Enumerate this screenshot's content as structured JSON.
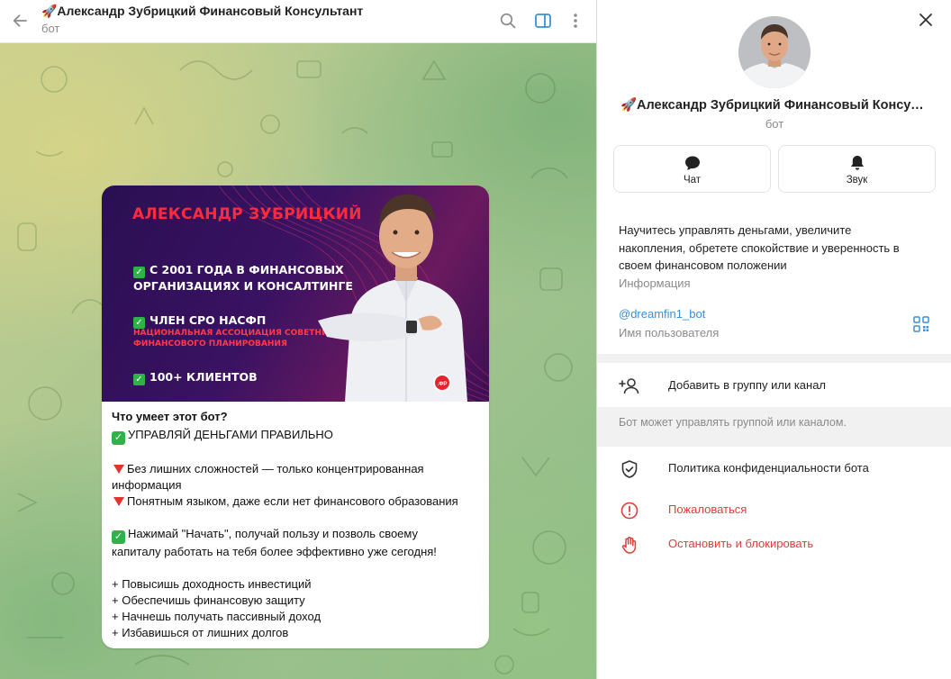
{
  "header": {
    "title": "🚀Александр Зубрицкий Финансовый Консультант",
    "subtitle": "бот",
    "icons": [
      "back-arrow-icon",
      "search-icon",
      "sidebar-toggle-icon",
      "more-vertical-icon"
    ]
  },
  "message": {
    "promo": {
      "name": "АЛЕКСАНДР ЗУБРИЦКИЙ",
      "line1a": "С 2001 ГОДА В ФИНАНСОВЫХ",
      "line1b": "ОРГАНИЗАЦИЯХ И КОНСАЛТИНГЕ",
      "line2": "ЧЛЕН СРО НАСФП",
      "line2_small_a": "НАЦИОНАЛЬНАЯ АССОЦИАЦИЯ СОВЕТНИКОВ",
      "line2_small_b": "ФИНАНСОВОГО ПЛАНИРОВАНИЯ",
      "line3": "100+ КЛИЕНТОВ",
      "badge": ".ФР"
    },
    "question": "Что умеет этот бот?",
    "p1": "УПРАВЛЯЙ ДЕНЬГАМИ ПРАВИЛЬНО",
    "p2a": "Без лишних сложностей — только концентрированная",
    "p2b": "информация",
    "p3": "Понятным языком, даже если нет финансового образования",
    "p4a": "Нажимай \"Начать\", получай пользу и позволь своему",
    "p4b": "капиталу работать на тебя более эффективно уже сегодня!",
    "bullets": [
      "+ Повысишь доходность инвестиций",
      "+ Обеспечишь финансовую защиту",
      "+ Начнешь получать пассивный доход",
      "+ Избавишься от лишних долгов"
    ]
  },
  "panel": {
    "name": "🚀Александр Зубрицкий Финансовый Консультант",
    "subtitle": "бот",
    "buttons": {
      "chat": "Чат",
      "sound": "Звук"
    },
    "about_l1": "Научитесь управлять деньгами, увеличите",
    "about_l2": "накопления, обретете спокойствие и  уверенность в",
    "about_l3": "своем финансовом положении",
    "about_caption": "Информация",
    "username": "@dreamfin1_bot",
    "username_caption": "Имя пользователя",
    "add_to_group": "Добавить в группу или канал",
    "group_hint": "Бот может управлять группой или каналом.",
    "privacy": "Политика конфиденциальности бота",
    "report": "Пожаловаться",
    "block": "Остановить и блокировать"
  },
  "colors": {
    "accent_blue": "#3a8fd9",
    "danger_red": "#d9403b",
    "promo_red": "#ff2b3d",
    "check_green": "#2fb24a"
  }
}
